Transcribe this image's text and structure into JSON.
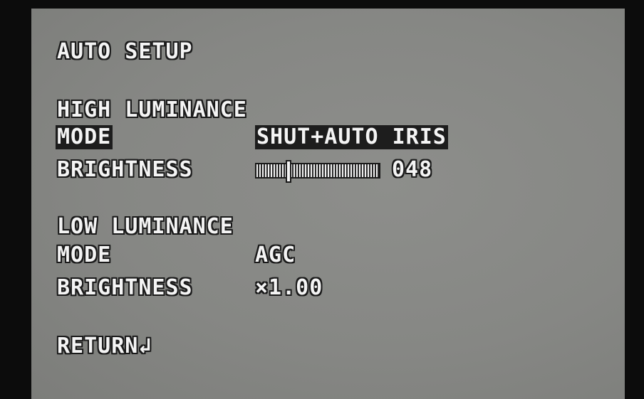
{
  "title": "AUTO SETUP",
  "high_luminance": {
    "heading": "HIGH LUMINANCE",
    "mode_label": "MODE",
    "mode_value": "SHUT+AUTO IRIS",
    "brightness_label": "BRIGHTNESS",
    "brightness_value": "048",
    "brightness_level": 0.25
  },
  "low_luminance": {
    "heading": "LOW LUMINANCE",
    "mode_label": "MODE",
    "mode_value": "AGC",
    "brightness_label": "BRIGHTNESS",
    "brightness_value": "×1.00"
  },
  "return_label": "RETURN↲"
}
